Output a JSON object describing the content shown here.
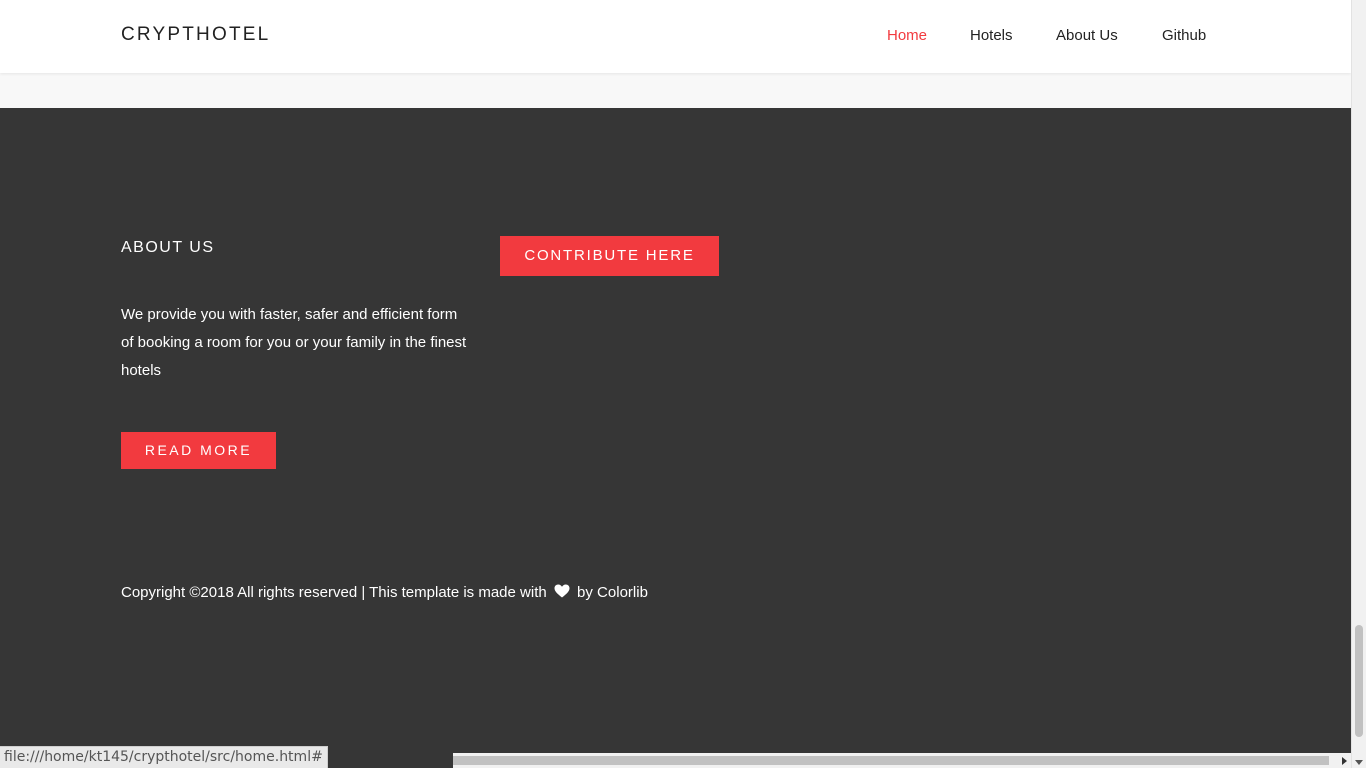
{
  "navbar": {
    "brand": "CRYPTHOTEL",
    "links": [
      {
        "label": "Home",
        "active": true
      },
      {
        "label": "Hotels",
        "active": false
      },
      {
        "label": "About Us",
        "active": false
      },
      {
        "label": "Github",
        "active": false
      }
    ]
  },
  "footer": {
    "about_title": "ABOUT US",
    "about_text": "We provide you with faster, safer and efficient form of booking a room for you or your family in the finest hotels",
    "read_more_label": "READ MORE",
    "contribute_label": "CONTRIBUTE HERE",
    "copyright_before": "Copyright ©2018 All rights reserved | This template is made with",
    "copyright_after": "by Colorlib",
    "heart_icon": "heart-icon"
  },
  "status_bar": {
    "url": "file:///home/kt145/crypthotel/src/home.html#"
  },
  "colors": {
    "accent": "#f23a3f",
    "footer_bg": "#363636",
    "navbar_bg": "#ffffff"
  }
}
